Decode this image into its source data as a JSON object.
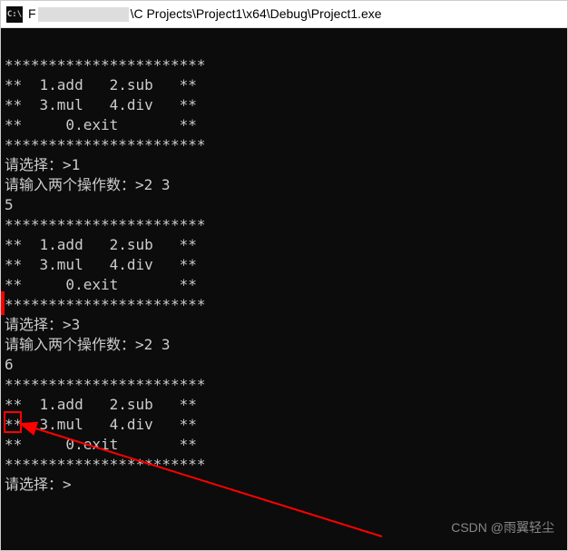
{
  "titlebar": {
    "icon_label": "C:\\",
    "prefix": "F",
    "path": "\\C Projects\\Project1\\x64\\Debug\\Project1.exe"
  },
  "console": {
    "lines": [
      "***********************",
      "**  1.add   2.sub   **",
      "**  3.mul   4.div   **",
      "**     0.exit       **",
      "***********************",
      "请选择：>1",
      "请输入两个操作数：>2 3",
      "5",
      "***********************",
      "**  1.add   2.sub   **",
      "**  3.mul   4.div   **",
      "**     0.exit       **",
      "***********************",
      "请选择：>3",
      "请输入两个操作数：>2 3",
      "6",
      "***********************",
      "**  1.add   2.sub   **",
      "**  3.mul   4.div   **",
      "**     0.exit       **",
      "***********************",
      "请选择：>"
    ]
  },
  "watermark": "CSDN @雨翼轻尘"
}
